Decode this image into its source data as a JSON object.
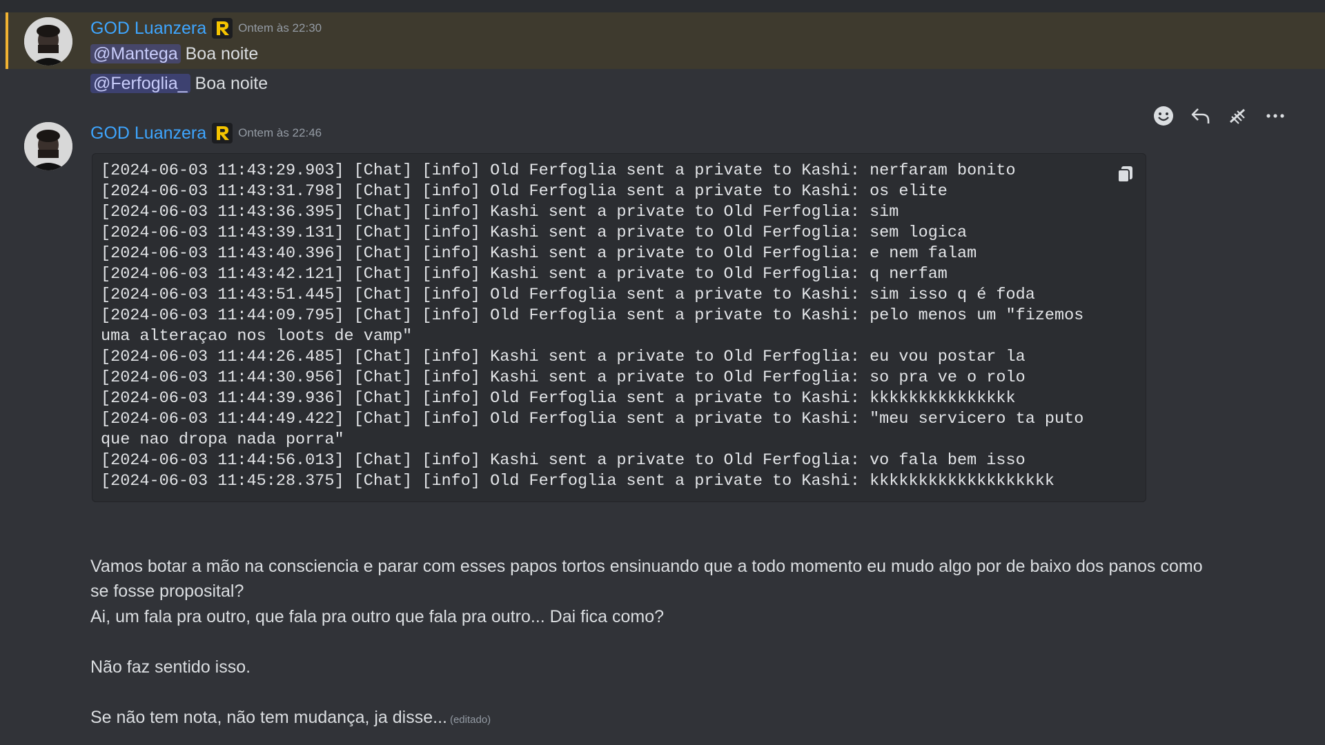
{
  "messages": [
    {
      "author": "GOD Luanzera",
      "timestamp": "Ontem às 22:30",
      "lines": [
        {
          "mention": "@Mantega",
          "text": "Boa noite"
        },
        {
          "mention": "@Ferfoglia_",
          "text": "Boa noite"
        }
      ]
    },
    {
      "author": "GOD Luanzera",
      "timestamp": "Ontem às 22:46",
      "code_lines": [
        "[2024-06-03 11:43:29.903] [Chat] [info] Old Ferfoglia sent a private to Kashi: nerfaram bonito",
        "[2024-06-03 11:43:31.798] [Chat] [info] Old Ferfoglia sent a private to Kashi: os elite",
        "[2024-06-03 11:43:36.395] [Chat] [info] Kashi sent a private to Old Ferfoglia: sim",
        "[2024-06-03 11:43:39.131] [Chat] [info] Kashi sent a private to Old Ferfoglia: sem logica",
        "[2024-06-03 11:43:40.396] [Chat] [info] Kashi sent a private to Old Ferfoglia: e nem falam",
        "[2024-06-03 11:43:42.121] [Chat] [info] Kashi sent a private to Old Ferfoglia: q nerfam",
        "[2024-06-03 11:43:51.445] [Chat] [info] Old Ferfoglia sent a private to Kashi: sim isso q é foda",
        "[2024-06-03 11:44:09.795] [Chat] [info] Old Ferfoglia sent a private to Kashi: pelo menos um \"fizemos",
        "uma alteraçao nos loots de vamp\"",
        "[2024-06-03 11:44:26.485] [Chat] [info] Kashi sent a private to Old Ferfoglia: eu vou postar la",
        "[2024-06-03 11:44:30.956] [Chat] [info] Kashi sent a private to Old Ferfoglia: so pra ve o rolo",
        "[2024-06-03 11:44:39.936] [Chat] [info] Old Ferfoglia sent a private to Kashi: kkkkkkkkkkkkkkk",
        "[2024-06-03 11:44:49.422] [Chat] [info] Old Ferfoglia sent a private to Kashi: \"meu servicero ta puto",
        "que nao dropa nada porra\"",
        "[2024-06-03 11:44:56.013] [Chat] [info] Kashi sent a private to Old Ferfoglia: vo fala bem isso",
        "[2024-06-03 11:45:28.375] [Chat] [info] Old Ferfoglia sent a private to Kashi: kkkkkkkkkkkkkkkkkkk"
      ],
      "paragraphs": [
        "Vamos botar a mão na consciencia e parar com esses papos tortos ensinuando que a todo momento eu  mudo algo por de baixo dos panos como",
        "se fosse proposital?",
        "Ai, um fala pra outro, que fala pra outro que fala pra outro... Dai fica como?",
        "Não faz sentido isso.",
        "Se não tem nota, não tem mudança, ja disse..."
      ],
      "edited_label": "(editado)"
    }
  ],
  "icons": {
    "role_badge": "r-role-badge-icon",
    "reaction": "smiley-icon",
    "reply": "reply-arrow-icon",
    "forward": "forward-icon",
    "more": "ellipsis-icon",
    "copy": "copy-icon"
  },
  "colors": {
    "background": "#313338",
    "username": "#3ea6ff",
    "highlight_bar": "#f0b232",
    "highlight_bg": "#3e3a2e",
    "mention_bg": "#4e5383",
    "code_bg": "#2b2d31",
    "badge_gold": "#f5c400"
  }
}
